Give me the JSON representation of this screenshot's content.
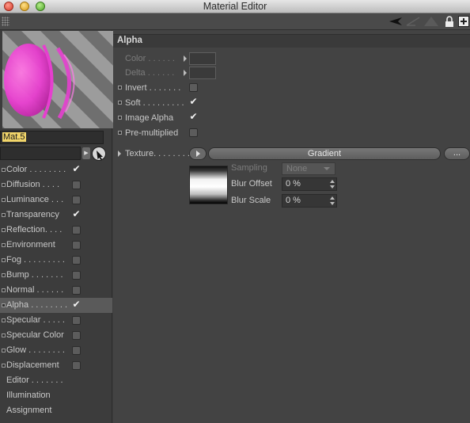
{
  "window": {
    "title": "Material Editor"
  },
  "material": {
    "name": "Mat.5"
  },
  "channels": [
    {
      "label": "Color . . . . . . . .",
      "has_checkbox": true,
      "checked": true,
      "selected": false
    },
    {
      "label": "Diffusion  . . . .",
      "has_checkbox": true,
      "checked": false,
      "selected": false
    },
    {
      "label": "Luminance . . .",
      "has_checkbox": true,
      "checked": false,
      "selected": false
    },
    {
      "label": "Transparency",
      "has_checkbox": true,
      "checked": true,
      "selected": false
    },
    {
      "label": "Reflection. . . .",
      "has_checkbox": true,
      "checked": false,
      "selected": false
    },
    {
      "label": "Environment",
      "has_checkbox": true,
      "checked": false,
      "selected": false
    },
    {
      "label": "Fog  . . . . . . . . .",
      "has_checkbox": true,
      "checked": false,
      "selected": false
    },
    {
      "label": "Bump  . . . . . . .",
      "has_checkbox": true,
      "checked": false,
      "selected": false
    },
    {
      "label": "Normal . . . . . .",
      "has_checkbox": true,
      "checked": false,
      "selected": false
    },
    {
      "label": "Alpha . . . . . . . .",
      "has_checkbox": true,
      "checked": true,
      "selected": true
    },
    {
      "label": "Specular . . . . .",
      "has_checkbox": true,
      "checked": false,
      "selected": false
    },
    {
      "label": "Specular Color",
      "has_checkbox": true,
      "checked": false,
      "selected": false
    },
    {
      "label": "Glow . . . . . . . .",
      "has_checkbox": true,
      "checked": false,
      "selected": false
    },
    {
      "label": "Displacement",
      "has_checkbox": true,
      "checked": false,
      "selected": false
    },
    {
      "label": "Editor . . . . . . .",
      "has_checkbox": false,
      "checked": false,
      "selected": false
    },
    {
      "label": "Illumination",
      "has_checkbox": false,
      "checked": false,
      "selected": false
    },
    {
      "label": "Assignment",
      "has_checkbox": false,
      "checked": false,
      "selected": false
    }
  ],
  "alpha": {
    "section_title": "Alpha",
    "color_label": "Color . . . . . .",
    "delta_label": "Delta . . . . . .",
    "invert_label": "Invert  . . . . . . .",
    "invert_checked": false,
    "soft_label": "Soft  . . . . . . . . .",
    "soft_checked": true,
    "image_alpha_label": "Image Alpha",
    "image_alpha_checked": true,
    "premultiplied_label": "Pre-multiplied",
    "premultiplied_checked": false,
    "texture_label": "Texture. . . . . . . .",
    "texture_button": "Gradient",
    "more_button": "...",
    "sampling_label": "Sampling",
    "sampling_value": "None",
    "blur_offset_label": "Blur Offset",
    "blur_offset_value": "0 %",
    "blur_scale_label": "Blur Scale",
    "blur_scale_value": "0 %"
  },
  "checkmark": "✔",
  "colors": {
    "material_pink": "#e83fcf",
    "selection": "#5a5a5a",
    "name_highlight": "#f1d56a"
  }
}
